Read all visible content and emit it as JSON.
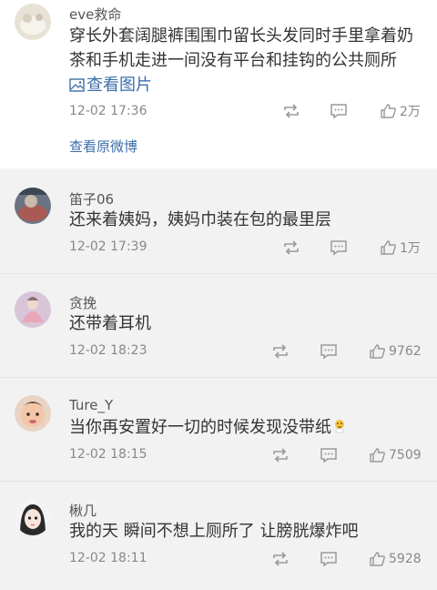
{
  "comments": [
    {
      "username": "eve救命",
      "text": "穿长外套阔腿裤围围巾留长头发同时手里拿着奶茶和手机走进一间没有平台和挂钩的公共厕所",
      "image_link": "查看图片",
      "time": "12-02 17:36",
      "likes": "2万",
      "view_original": "查看原微博"
    },
    {
      "username": "笛子06",
      "text": "还来着姨妈，姨妈巾装在包的最里层",
      "time": "12-02 17:39",
      "likes": "1万"
    },
    {
      "username": "贪挽",
      "text": "还带着耳机",
      "time": "12-02 18:23",
      "likes": "9762"
    },
    {
      "username": "Ture_Y",
      "text": "当你再安置好一切的时候发现没带纸",
      "time": "12-02 18:15",
      "likes": "7509"
    },
    {
      "username": "楸几",
      "text": "我的天 瞬间不想上厕所了 让膀胱爆炸吧",
      "time": "12-02 18:11",
      "likes": "5928"
    }
  ],
  "icons": {
    "repost": "repost-icon",
    "comment": "comment-icon",
    "like": "thumbs-up-icon",
    "image": "image-icon"
  },
  "colors": {
    "link": "#3b6ea8",
    "meta": "#888888",
    "text": "#333333"
  }
}
